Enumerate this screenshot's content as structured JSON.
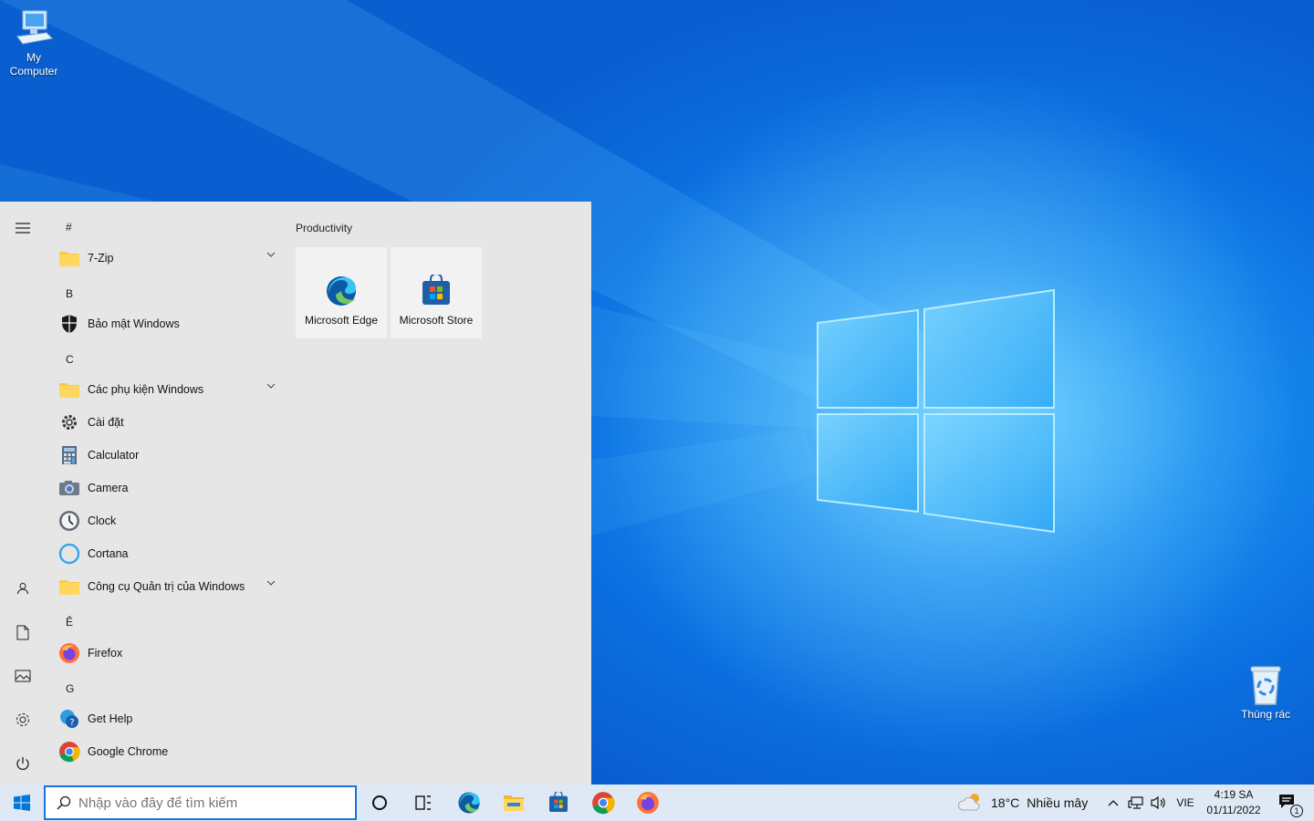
{
  "desktop": {
    "icons": [
      {
        "label": "My\nComputer",
        "icon": "computer-icon"
      },
      {
        "label": "Thùng rác",
        "icon": "recycle-bin-icon"
      }
    ]
  },
  "start_menu": {
    "rail": [
      "hamburger-menu-icon",
      "user-icon",
      "documents-icon",
      "pictures-icon",
      "settings-icon",
      "power-icon"
    ],
    "groups": {
      "hash": "#",
      "b": "B",
      "c": "C",
      "e": "Ê",
      "g": "G"
    },
    "apps": {
      "zip": "7-Zip",
      "security": "Bảo mật Windows",
      "accessories": "Các phụ kiện Windows",
      "settings": "Cài đặt",
      "calculator": "Calculator",
      "camera": "Camera",
      "clock": "Clock",
      "cortana": "Cortana",
      "admin_tools": "Công cụ Quản trị của Windows",
      "firefox": "Firefox",
      "get_help": "Get Help",
      "chrome": "Google Chrome"
    },
    "tiles_group": "Productivity",
    "tiles": {
      "edge": "Microsoft Edge",
      "store": "Microsoft Store"
    }
  },
  "taskbar": {
    "search_placeholder": "Nhập vào đây để tìm kiếm",
    "weather_temp": "18°C",
    "weather_desc": "Nhiều mây",
    "language": "VIE",
    "time": "4:19 SA",
    "date": "01/11/2022",
    "notification_count": "1"
  },
  "colors": {
    "accent": "#0078d7",
    "start_bg": "#e6e6e6",
    "taskbar_bg": "#dfe9f5"
  }
}
